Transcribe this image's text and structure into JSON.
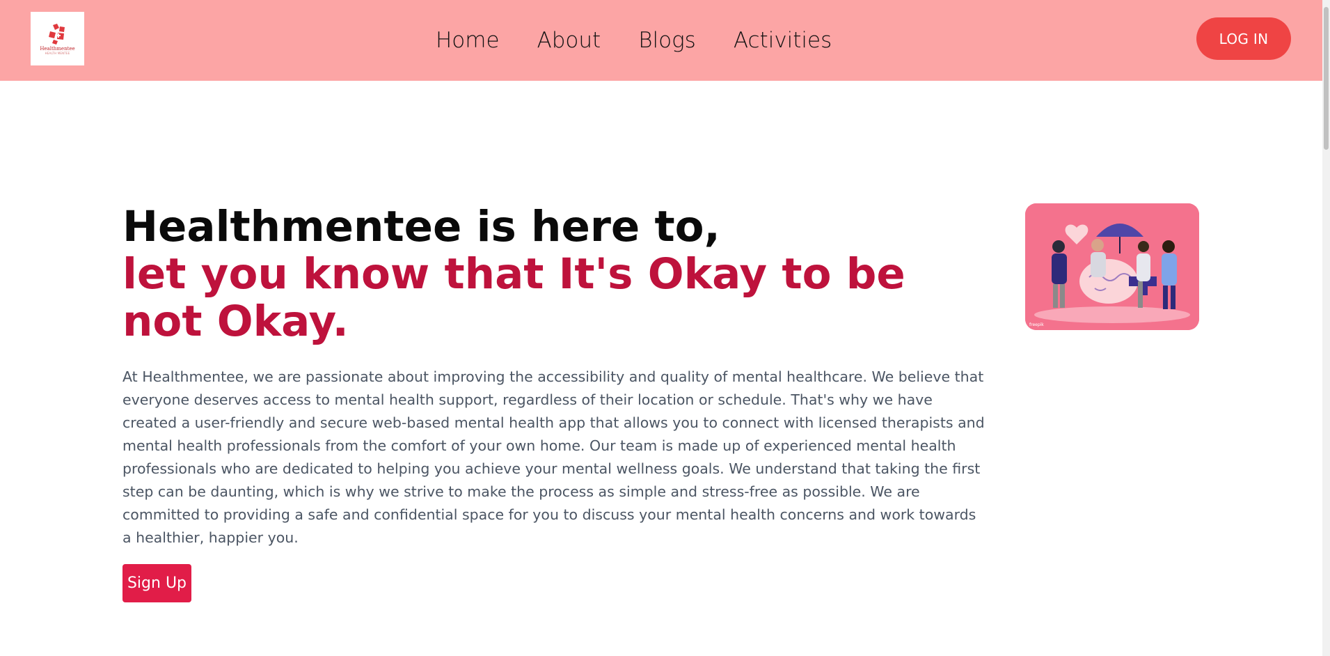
{
  "header": {
    "logo_text": "Healthmentee",
    "logo_subtitle": "HEALTH MENTEE",
    "nav": [
      "Home",
      "About",
      "Blogs",
      "Activities"
    ],
    "login_label": "LOG IN"
  },
  "hero": {
    "title_line1": "Healthmentee is here to,",
    "title_line2": "let you know that It's Okay to be not Okay.",
    "description": "At Healthmentee, we are passionate about improving the accessibility and quality of mental healthcare. We believe that everyone deserves access to mental health support, regardless of their location or schedule. That's why we have created a user-friendly and secure web-based mental health app that allows you to connect with licensed therapists and mental health professionals from the comfort of your own home. Our team is made up of experienced mental health professionals who are dedicated to helping you achieve your mental wellness goals. We understand that taking the first step can be daunting, which is why we strive to make the process as simple and stress-free as possible. We are committed to providing a safe and confidential space for you to discuss your mental health concerns and work towards a healthier, happier you.",
    "signup_label": "Sign Up",
    "image_caption": "freepik"
  },
  "colors": {
    "navbar_bg": "#fca5a5",
    "login_bg": "#ef4444",
    "accent_heading": "#be123c",
    "signup_bg": "#e11d48"
  }
}
